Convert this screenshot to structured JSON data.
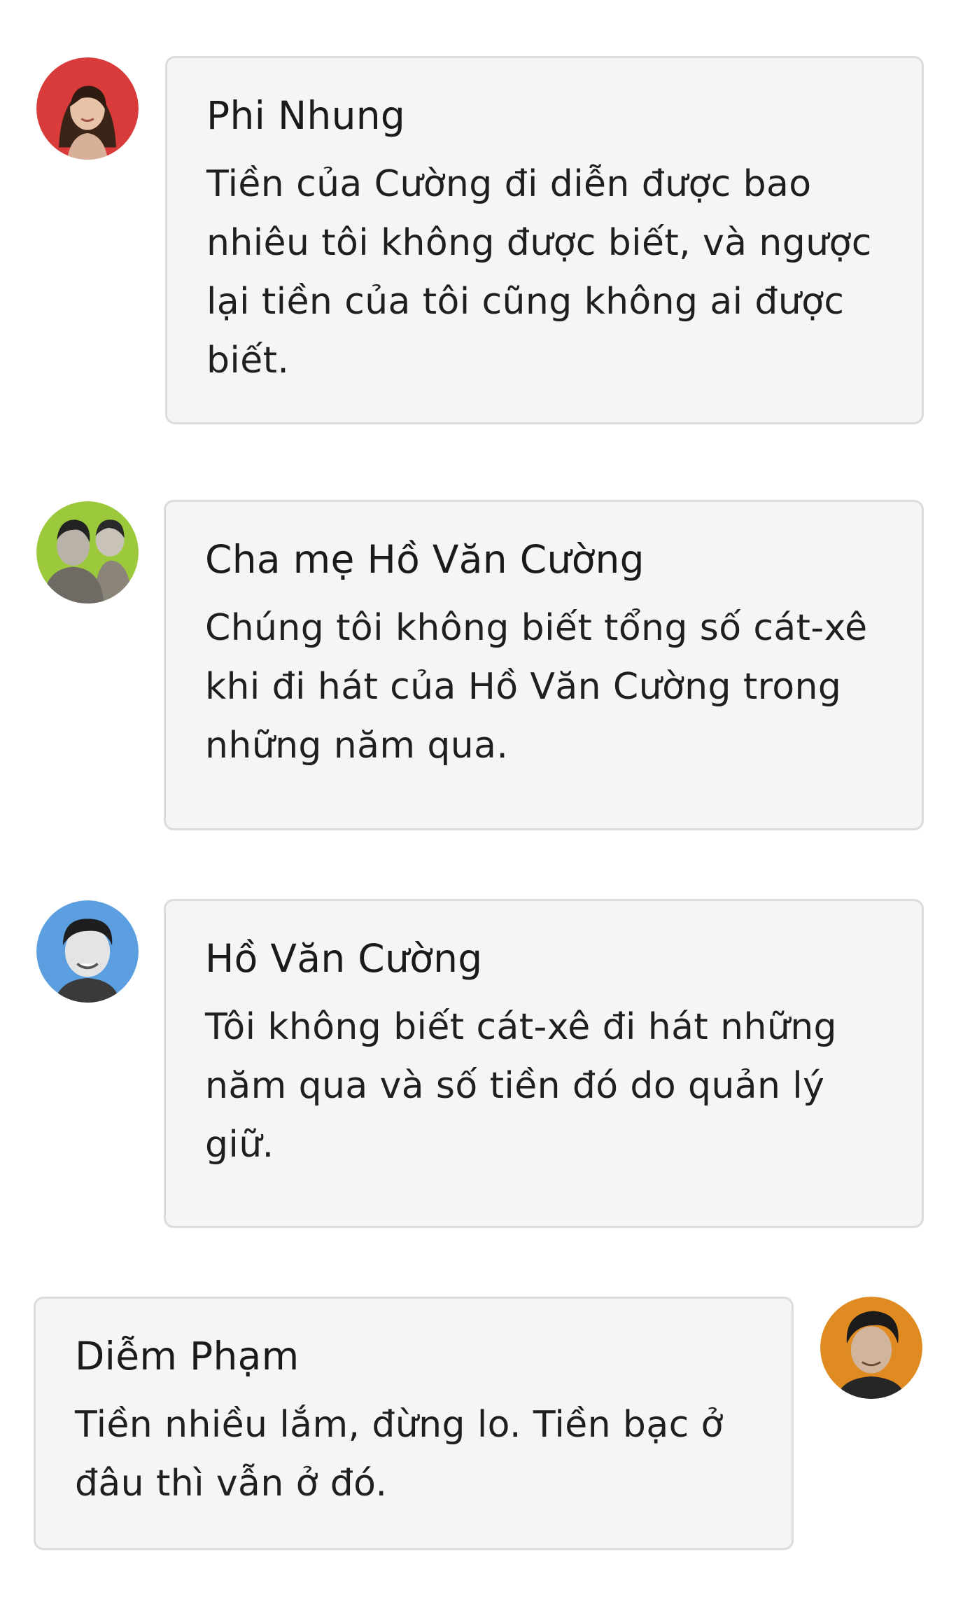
{
  "messages": [
    {
      "name": "Phi Nhung",
      "text": "Tiền của Cường đi diễn được bao nhiêu tôi không được biết, và ngược lại tiền của tôi cũng không ai được biết.",
      "avatar_bg": "#d93a3a"
    },
    {
      "name": "Cha mẹ Hồ Văn Cường",
      "text": "Chúng tôi không biết tổng số cát-xê khi đi hát của Hồ Văn Cường trong những năm qua.",
      "avatar_bg": "#9bc93b"
    },
    {
      "name": "Hồ Văn Cường",
      "text": "Tôi không biết cát-xê đi hát những năm qua và số tiền đó do quản lý giữ.",
      "avatar_bg": "#5b9fe0"
    },
    {
      "name": "Diễm Phạm",
      "text": "Tiền nhiều lắm, đừng lo. Tiền bạc ở đâu thì vẫn ở đó.",
      "avatar_bg": "#e08a22"
    }
  ],
  "colors": {
    "bubble_bg": "#f5f5f5",
    "bubble_border": "#dcdcdc",
    "text": "#1f1f1f"
  }
}
